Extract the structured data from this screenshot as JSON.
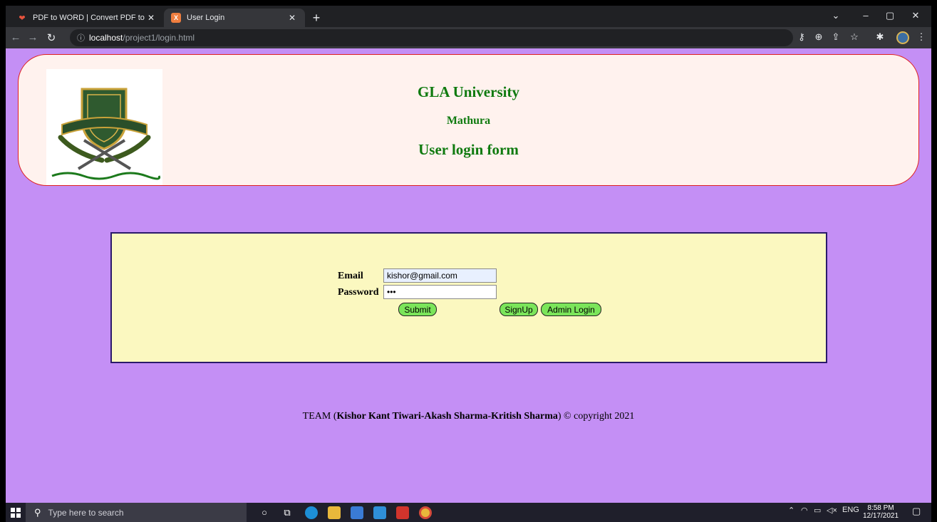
{
  "browser": {
    "tabs": [
      {
        "title": "PDF to WORD | Convert PDF to W",
        "favicon": "pdf-heart-icon",
        "active": false
      },
      {
        "title": "User Login",
        "favicon": "xampp-icon",
        "active": true
      }
    ],
    "url": {
      "host": "localhost",
      "path": "/project1/login.html"
    }
  },
  "page": {
    "logo_alt": "GLA University crest",
    "heading": {
      "university": "GLA University",
      "city": "Mathura",
      "form_title": "User login form"
    },
    "form": {
      "email_label": "Email",
      "email_value": "kishor@gmail.com",
      "password_label": "Password",
      "password_value": "•••",
      "submit_label": "Submit",
      "signup_label": "SignUp",
      "admin_login_label": "Admin Login"
    },
    "footer": {
      "prefix": "TEAM (",
      "names": "Kishor Kant Tiwari-Akash Sharma-Kritish Sharma",
      "suffix": ") © copyright 2021"
    }
  },
  "taskbar": {
    "search_placeholder": "Type here to search",
    "language": "ENG",
    "time": "8:58 PM",
    "date": "12/17/2021"
  },
  "colors": {
    "page_bg": "#c48ff5",
    "header_bg": "#fff2ee",
    "header_border": "#e02020",
    "heading_text": "#0f7a0f",
    "login_bg": "#fbf8c0",
    "button_bg": "#7be55a"
  }
}
